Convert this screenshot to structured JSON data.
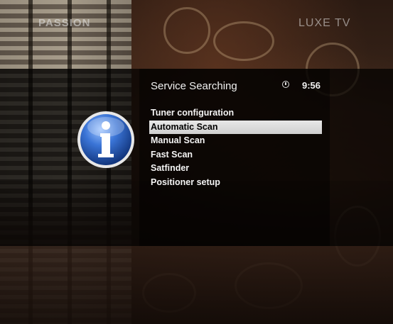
{
  "channel_logos": {
    "left": "PASSION",
    "right": "LUXE TV"
  },
  "menu": {
    "title": "Service Searching",
    "clock": "9:56",
    "items": [
      {
        "label": "Tuner configuration",
        "selected": false
      },
      {
        "label": "Automatic Scan",
        "selected": true
      },
      {
        "label": "Manual Scan",
        "selected": false
      },
      {
        "label": "Fast Scan",
        "selected": false
      },
      {
        "label": "Satfinder",
        "selected": false
      },
      {
        "label": "Positioner setup",
        "selected": false
      }
    ]
  },
  "icons": {
    "info": "info-icon",
    "clock": "clock-icon"
  },
  "colors": {
    "selection_bg": "#e0e0e0",
    "menu_text": "#f4f4f4",
    "info_blue": "#2a63c9"
  }
}
